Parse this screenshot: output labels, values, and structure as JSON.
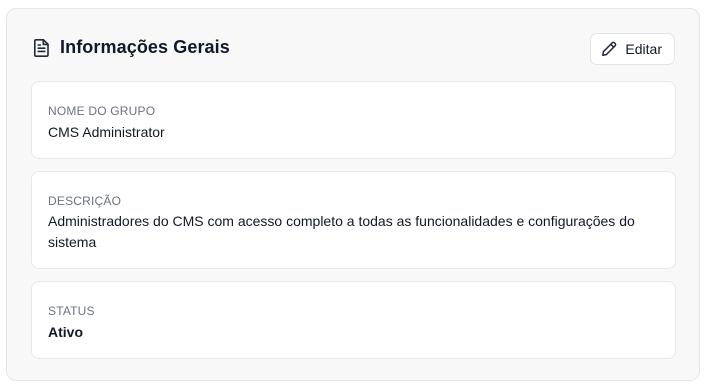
{
  "header": {
    "title": "Informações Gerais",
    "title_icon": "document-icon",
    "edit_label": "Editar",
    "edit_icon": "pencil-icon"
  },
  "fields": [
    {
      "label": "NOME DO GRUPO",
      "value": "CMS Administrator"
    },
    {
      "label": "DESCRIÇÃO",
      "value": "Administradores do CMS com acesso completo a todas as funcionalidades e configurações do sistema"
    },
    {
      "label": "STATUS",
      "value": "Ativo"
    }
  ],
  "colors": {
    "card_background": "#f8f8f9",
    "field_background": "#ffffff",
    "border": "#e3e5e8",
    "label_text": "#6b7280",
    "text": "#111827"
  }
}
